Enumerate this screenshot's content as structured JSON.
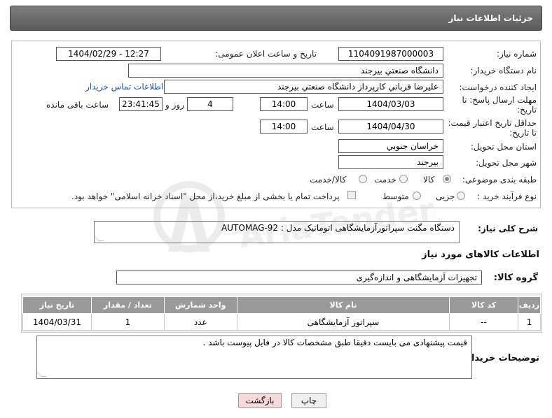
{
  "header": {
    "title": "جزئیات اطلاعات نیاز"
  },
  "fields": {
    "need_number_label": "شماره نیاز:",
    "need_number": "1104091987000003",
    "announce_label": "تاریخ و ساعت اعلان عمومی:",
    "announce_value": "1404/02/29 - 12:27",
    "buyer_org_label": "نام دستگاه خریدار:",
    "buyer_org": "دانشگاه صنعتي بيرجند",
    "requester_label": "ایجاد کننده درخواست:",
    "requester": "عليرضا قرباني كارپرداز دانشگاه صنعتي بيرجند",
    "contact_link": "اطلاعات تماس خریدار",
    "deadline_label_1": "مهلت ارسال پاسخ: تا",
    "deadline_label_2": "تاریخ:",
    "deadline_date": "1404/03/03",
    "time_label": "ساعت",
    "deadline_time": "14:00",
    "days_value": "4",
    "days_label": "روز و",
    "remaining_time": "23:41:45",
    "remaining_label": "ساعت باقی مانده",
    "validity_label_1": "حداقل تاریخ اعتبار قیمت:",
    "validity_label_2": "تا تاریخ:",
    "validity_date": "1404/04/30",
    "validity_time_label": "ساعت",
    "validity_time": "14:00",
    "province_label": "استان محل تحویل:",
    "province": "خراسان جنوبي",
    "city_label": "شهر محل تحویل:",
    "city": "بيرجند",
    "category_label": "طبقه بندی موضوعی:",
    "category_options": [
      "کالا",
      "خدمت",
      "کالا/خدمت"
    ],
    "category_selected": "کالا",
    "process_label": "نوع فرآیند خرید :",
    "process_options": [
      "جزیی",
      "متوسط"
    ],
    "process_note": "پرداخت تمام یا بخشی از مبلغ خرید،از محل \"اسناد خزانه اسلامی\" خواهد بود."
  },
  "description": {
    "label": "شرح کلی نیاز:",
    "value": "دستگاه مگنت سپراتورآزمایشگاهی اتوماتیک مدل : AUTOMAG-92"
  },
  "goods_section": {
    "title": "اطلاعات کالاهای مورد نیاز",
    "group_label": "گروه کالا:",
    "group_value": "تجهیزات آزمایشگاهی و اندازه‌گیری"
  },
  "table": {
    "headers": [
      "ردیف",
      "کد کالا",
      "نام کالا",
      "واحد شمارش",
      "تعداد / مقدار",
      "تاریخ نیاز"
    ],
    "rows": [
      [
        "1",
        "--",
        "سپراتور آزمایشگاهی",
        "عدد",
        "1",
        "1404/03/31"
      ]
    ]
  },
  "buyer_notes": {
    "label": "توضیحات خریدار:",
    "value": "قیمت پیشنهادی می بایست دقیقا طبق مشخصات کالا در فایل پیوست باشد ."
  },
  "buttons": {
    "print": "چاپ",
    "back": "بازگشت"
  },
  "watermark": {
    "text": "AriaTender.net"
  },
  "colors": {
    "header_bg": "#6b6b6b",
    "table_header_bg": "#9a9a9a",
    "link": "#1a4fb8",
    "back_button_bg": "#f7d9d9"
  }
}
